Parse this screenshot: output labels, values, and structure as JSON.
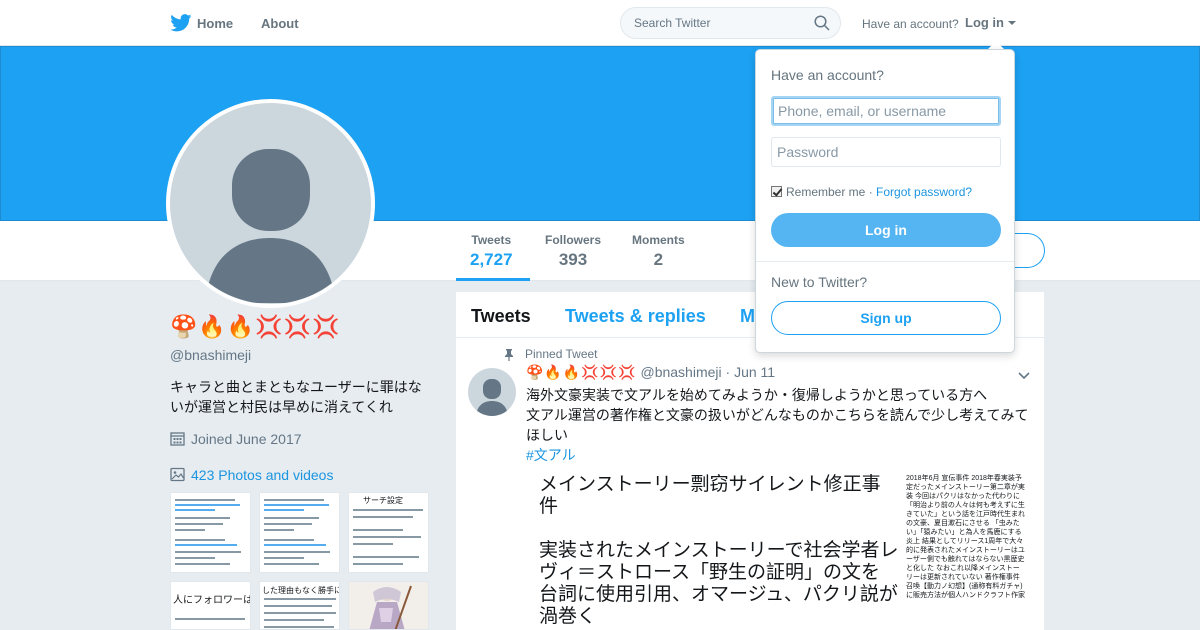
{
  "nav": {
    "home_label": "Home",
    "about_label": "About",
    "search_placeholder": "Search Twitter",
    "have_account_label": "Have an account?",
    "login_label": "Log in"
  },
  "colors": {
    "brand_blue": "#1da1f2",
    "link_blue": "#1b95e0",
    "avatar_gray": "#ccd6dd",
    "silhouette_gray": "#657786"
  },
  "profile": {
    "display_name": "🍄🔥🔥💢💢💢",
    "handle": "@bnashimeji",
    "bio": "キャラと曲とまともなユーザーに罪はないが運営と村民は早めに消えてくれ",
    "joined": "Joined June 2017",
    "photos_link": "423 Photos and videos"
  },
  "stats": [
    {
      "label": "Tweets",
      "value": "2,727"
    },
    {
      "label": "Followers",
      "value": "393"
    },
    {
      "label": "Moments",
      "value": "2"
    }
  ],
  "thumbs": [
    {
      "text": ""
    },
    {
      "text": ""
    },
    {
      "text": "サーチ設定"
    },
    {
      "text": "人にフォロワーはい"
    },
    {
      "text": "した理由もなく勝手に消えて"
    },
    {
      "text": ""
    }
  ],
  "timeline": {
    "tabs": [
      "Tweets",
      "Tweets & replies",
      "M"
    ],
    "pinned_label": "Pinned Tweet",
    "tweet": {
      "name": "🍄🔥🔥💢💢💢",
      "handle": "@bnashimeji",
      "date": "· Jun 11",
      "text_lines": [
        "海外文豪実装で文アルを始めてみようか・復帰しようかと思っている方へ",
        "文アル運営の著作権と文豪の扱いがどんなものかこちらを読んで少し考えてみてほしい"
      ],
      "hashtag": "#文アル",
      "media_heading": "メインストーリー剽窃サイレント修正事件",
      "media_body": "実装されたメインストーリーで社会学者レヴィ＝ストロース「野生の証明」の文を台詞に使用引用、オマージュ、パクリ説が渦巻く",
      "media_side": "2018年6月 宣伝事件 2018年春実装予定だったメインストーリー第二章が実装 今回はパクリはなかった代わりに「明治より前の人々は何も考えずに生きていた」という話を江戸時代生まれの文豪、夏目漱石にさせる 「虫みたい」「猿みたい」と為人を馬鹿にする 炎上 結果としてリリース1周年で大々的に発表されたメインストーリーはユーザー側でも触れてはならない黒歴史と化した なおこれ以降メインストーリーは更新されていない 著作権事件 召喚【動力ノ幻想】(通称有料ガチャ)に販売方法が個人ハンドクラフト作家"
    }
  },
  "login_dropdown": {
    "title": "Have an account?",
    "username_placeholder": "Phone, email, or username",
    "password_placeholder": "Password",
    "remember_label": "Remember me",
    "separator": " · ",
    "forgot_label": "Forgot password?",
    "login_button": "Log in",
    "new_label": "New to Twitter?",
    "signup_button": "Sign up"
  }
}
